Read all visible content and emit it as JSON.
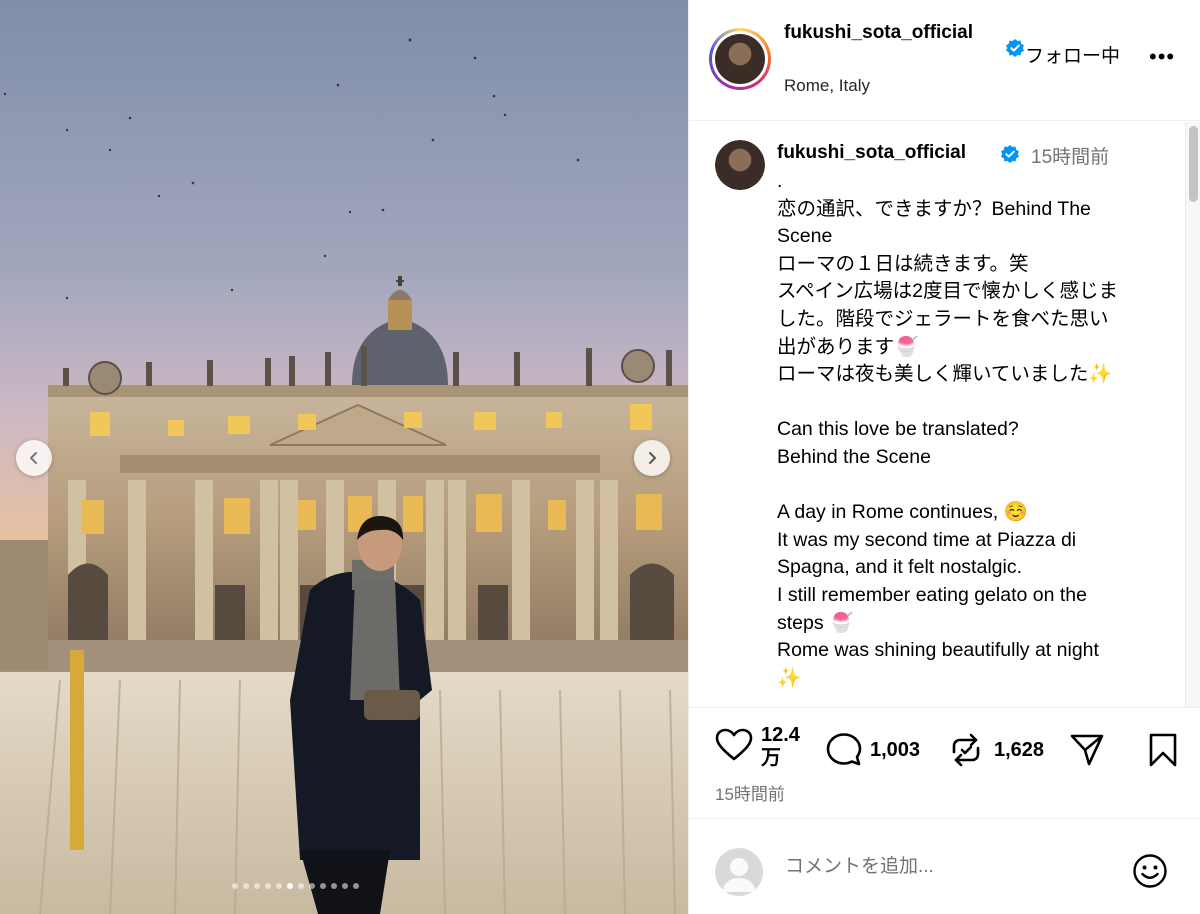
{
  "post": {
    "username": "fukushi_sota_official",
    "location": "Rome, Italy",
    "follow_status": "フォロー中",
    "more_label": "•••"
  },
  "caption": {
    "username": "fukushi_sota_official",
    "time_ago": "15時間前",
    "lines": [
      ".",
      "恋の通訳、できますか？Behind The",
      "Scene",
      "ローマの１日は続きます。笑",
      "スペイン広場は2度目で懐かしく感じま",
      "した。階段でジェラートを食べた思い",
      "出があります🍧",
      "ローマは夜も美しく輝いていました✨",
      "",
      "Can this love be translated?",
      "Behind the Scene",
      "",
      "A day in Rome continues, ☺️",
      "It was my second time at Piazza di",
      "Spagna, and it felt nostalgic.",
      "I still remember eating gelato on the",
      "steps 🍧",
      "Rome was shining beautifully at night",
      "✨"
    ]
  },
  "actions": {
    "likes": "12.4 万",
    "comments": "1,003",
    "reposts": "1,628",
    "time_ago": "15時間前"
  },
  "comment_box": {
    "placeholder": "コメントを追加..."
  },
  "carousel": {
    "slide_count": 12,
    "active_index": 5
  },
  "colors": {
    "verified": "#0095f6",
    "secondary_text": "#737373",
    "divider": "#efefef"
  }
}
